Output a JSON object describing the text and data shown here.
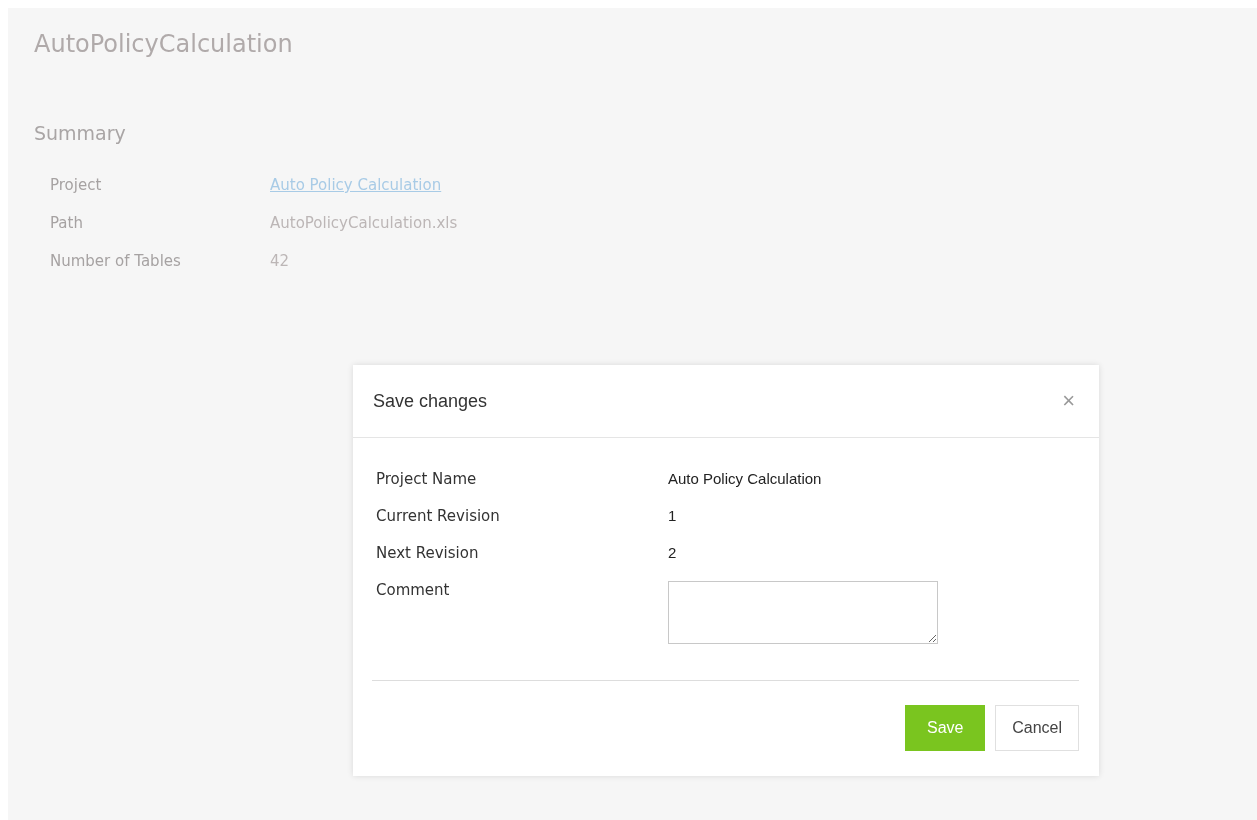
{
  "page": {
    "title": "AutoPolicyCalculation",
    "section": "Summary",
    "summary": [
      {
        "label": "Project",
        "value": "Auto Policy Calculation",
        "kind": "link"
      },
      {
        "label": "Path",
        "value": "AutoPolicyCalculation.xls",
        "kind": "text"
      },
      {
        "label": "Number of Tables",
        "value": "42",
        "kind": "text"
      }
    ]
  },
  "dialog": {
    "title": "Save changes",
    "close": "×",
    "fields": [
      {
        "label": "Project Name",
        "value": "Auto Policy Calculation",
        "kind": "text"
      },
      {
        "label": "Current Revision",
        "value": "1",
        "kind": "text"
      },
      {
        "label": "Next Revision",
        "value": "2",
        "kind": "text"
      },
      {
        "label": "Comment",
        "kind": "textarea"
      }
    ],
    "buttons": [
      {
        "label": "Save",
        "kind": "primary"
      },
      {
        "label": "Cancel",
        "kind": "default"
      }
    ]
  }
}
